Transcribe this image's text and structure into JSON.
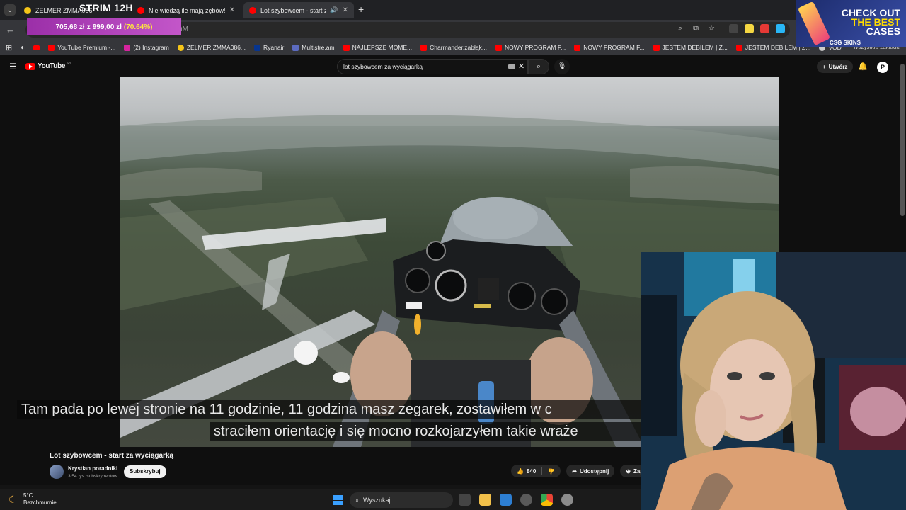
{
  "browser": {
    "tabs": [
      {
        "label": "ZELMER ZMMA086",
        "icon_color": "#f5c518"
      },
      {
        "label": "Nie wiedzą ile mają zębów! - Yo",
        "icon_color": "#ff0000"
      },
      {
        "label": "Lot szybowcem - start za w",
        "icon_color": "#ff0000"
      }
    ],
    "stream_label": "STRIM 12H",
    "price_overlay": {
      "current": "705,68 zł",
      "connector": "z",
      "target": "999,00 zł",
      "percent": "(70.64%)"
    },
    "url_fragment": "INZuM",
    "bookmarks": [
      {
        "label": "YouTube Premium -...",
        "color": "#ff0000"
      },
      {
        "label": "(2) Instagram",
        "color": "#d6249f"
      },
      {
        "label": "ZELMER ZMMA086...",
        "color": "#f5c518"
      },
      {
        "label": "Ryanair",
        "color": "#073590"
      },
      {
        "label": "Multistre.am",
        "color": "#5c6bc0"
      },
      {
        "label": "NAJLEPSZE MOME...",
        "color": "#ff0000"
      },
      {
        "label": "Charmander,zabłąk...",
        "color": "#ff0000"
      },
      {
        "label": "NOWY PROGRAM F...",
        "color": "#ff0000"
      },
      {
        "label": "NOWY PROGRAM F...",
        "color": "#ff0000"
      },
      {
        "label": "JESTEM DEBILEM | Z...",
        "color": "#ff0000"
      },
      {
        "label": "JESTEM DEBILEM | Z...",
        "color": "#ff0000"
      },
      {
        "label": "VOD",
        "color": "#cccccc"
      }
    ],
    "bookmarks_right": "Wszystkie zakładki"
  },
  "ad": {
    "line1": "CHECK OUT",
    "line2": "THE BEST",
    "line3": "CASES",
    "brand": "CSG SKINS"
  },
  "youtube": {
    "logo_text": "YouTube",
    "logo_region": "PL",
    "search_query": "lot szybowcem za wyciągarką",
    "create_label": "Utwórz",
    "video_title": "Lot szybowcem - start za wyciągarką",
    "channel_name": "Krystian poradniki",
    "channel_subs": "3,54 tys. subskrybentów",
    "subscribe_label": "Subskrybuj",
    "likes": "840",
    "share_label": "Udostępnij",
    "save_label": "Zapisz",
    "subtitle_line1": "Tam pada po lewej stronie na 11 godzinie, 11 godzina masz zegarek,  zostawiłem w c",
    "subtitle_line2": "straciłem orientację i się mocno rozkojarzyłem takie wraże"
  },
  "taskbar": {
    "temperature": "5°C",
    "weather": "Bezchmurnie",
    "search_label": "Wyszukaj"
  }
}
